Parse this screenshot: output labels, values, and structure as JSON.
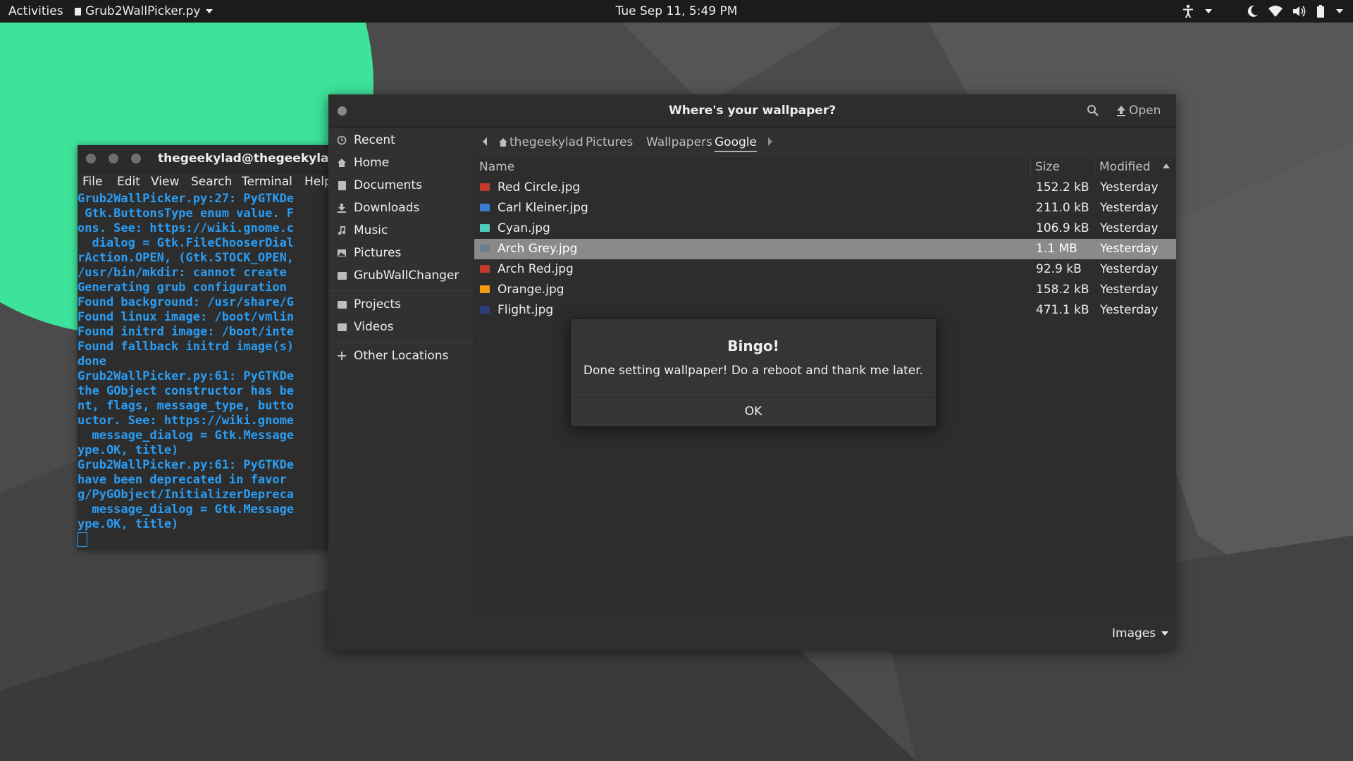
{
  "topbar": {
    "activities": "Activities",
    "app_name": "Grub2WallPicker.py",
    "clock": "Tue Sep 11,  5:49 PM",
    "tray_icons": [
      "accessibility-icon",
      "night-light-icon",
      "wifi-icon",
      "volume-icon",
      "battery-icon",
      "system-menu-arrow-icon"
    ]
  },
  "terminal": {
    "title": "thegeekylad@thegeekylad:~",
    "menu": [
      "File",
      "Edit",
      "View",
      "Search",
      "Terminal",
      "Help"
    ],
    "lines": [
      "Grub2WallPicker.py:27: PyGTKDe",
      " Gtk.ButtonsType enum value. F",
      "ons. See: https://wiki.gnome.c",
      "  dialog = Gtk.FileChooserDial",
      "rAction.OPEN, (Gtk.STOCK_OPEN,",
      "/usr/bin/mkdir: cannot create ",
      "Generating grub configuration ",
      "Found background: /usr/share/G",
      "Found linux image: /boot/vmlin",
      "Found initrd image: /boot/inte",
      "Found fallback initrd image(s)",
      "done",
      "Grub2WallPicker.py:61: PyGTKDe",
      "the GObject constructor has be",
      "nt, flags, message_type, butto",
      "uctor. See: https://wiki.gnome",
      "  message_dialog = Gtk.Message",
      "ype.OK, title)",
      "Grub2WallPicker.py:61: PyGTKDe",
      "have been deprecated in favor ",
      "g/PyGObject/InitializerDepreca",
      "  message_dialog = Gtk.Message",
      "ype.OK, title)"
    ],
    "text_color": "#2a9df4"
  },
  "filechooser": {
    "title": "Where's your wallpaper?",
    "open_label": "Open",
    "sidebar": {
      "places": [
        {
          "label": "Recent",
          "icon": "clock-icon"
        },
        {
          "label": "Home",
          "icon": "home-icon"
        },
        {
          "label": "Documents",
          "icon": "document-icon"
        },
        {
          "label": "Downloads",
          "icon": "download-icon"
        },
        {
          "label": "Music",
          "icon": "music-icon"
        },
        {
          "label": "Pictures",
          "icon": "pictures-icon"
        },
        {
          "label": "GrubWallChanger",
          "icon": "folder-icon"
        }
      ],
      "bookmarks": [
        {
          "label": "Projects",
          "icon": "folder-icon"
        },
        {
          "label": "Videos",
          "icon": "folder-icon"
        }
      ],
      "other_locations": "Other Locations"
    },
    "path": [
      "thegeekylad",
      "Pictures",
      "Wallpapers",
      "Google"
    ],
    "columns": {
      "name": "Name",
      "size": "Size",
      "modified": "Modified"
    },
    "files": [
      {
        "name": "Red Circle.jpg",
        "size": "152.2 kB",
        "modified": "Yesterday",
        "thumb_color": "#c0392b",
        "selected": false
      },
      {
        "name": "Carl Kleiner.jpg",
        "size": "211.0 kB",
        "modified": "Yesterday",
        "thumb_color": "#3b7bd6",
        "selected": false
      },
      {
        "name": "Cyan.jpg",
        "size": "106.9 kB",
        "modified": "Yesterday",
        "thumb_color": "#4fc9b8",
        "selected": false
      },
      {
        "name": "Arch Grey.jpg",
        "size": "1.1 MB",
        "modified": "Yesterday",
        "thumb_color": "#6a7f8f",
        "selected": true
      },
      {
        "name": "Arch Red.jpg",
        "size": "92.9 kB",
        "modified": "Yesterday",
        "thumb_color": "#c0392b",
        "selected": false
      },
      {
        "name": "Orange.jpg",
        "size": "158.2 kB",
        "modified": "Yesterday",
        "thumb_color": "#f39c12",
        "selected": false
      },
      {
        "name": "Flight.jpg",
        "size": "471.1 kB",
        "modified": "Yesterday",
        "thumb_color": "#2c3e7a",
        "selected": false
      }
    ],
    "filter": "Images"
  },
  "dialog": {
    "title": "Bingo!",
    "message": "Done setting wallpaper! Do a reboot and thank me later.",
    "ok_label": "OK"
  },
  "colors": {
    "wallpaper_green": "#3de39a",
    "topbar_bg": "#1b1b1b",
    "selection": "#8a8a8a"
  }
}
